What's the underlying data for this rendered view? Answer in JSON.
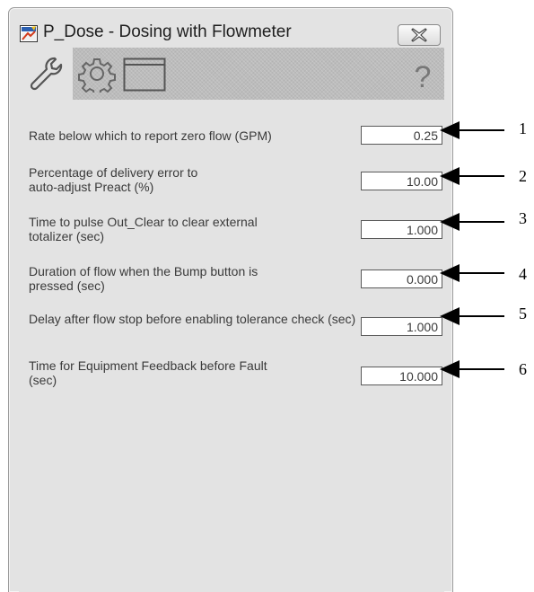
{
  "window": {
    "title": "P_Dose - Dosing with Flowmeter",
    "close_icon": "close-icon",
    "help_glyph": "?"
  },
  "toolbar": {
    "tabs": [
      {
        "icon": "wrench-icon",
        "selected": true
      },
      {
        "icon": "gear-icon",
        "selected": false
      },
      {
        "icon": "window-icon",
        "selected": false
      }
    ],
    "help_icon": "help-icon"
  },
  "params": [
    {
      "label": "Rate below which to report zero flow (GPM)",
      "value": "0.25"
    },
    {
      "label": "Percentage of delivery error to auto-adjust Preact (%)",
      "value": "10.00"
    },
    {
      "label": "Time to pulse Out_Clear to clear external totalizer (sec)",
      "value": "1.000"
    },
    {
      "label": "Duration of flow when the Bump button is pressed (sec)",
      "value": "0.000"
    },
    {
      "label": "Delay after flow stop before enabling tolerance check (sec)",
      "value": "1.000"
    },
    {
      "label": "Time for Equipment Feedback before Fault (sec)",
      "value": "10.000"
    }
  ],
  "callouts": [
    "1",
    "2",
    "3",
    "4",
    "5",
    "6"
  ],
  "colors": {
    "window_bg": "#e3e3e3",
    "toolbar_bg": "#bcbcbc",
    "label_text": "#3a3a3a",
    "callout": "#000000"
  }
}
